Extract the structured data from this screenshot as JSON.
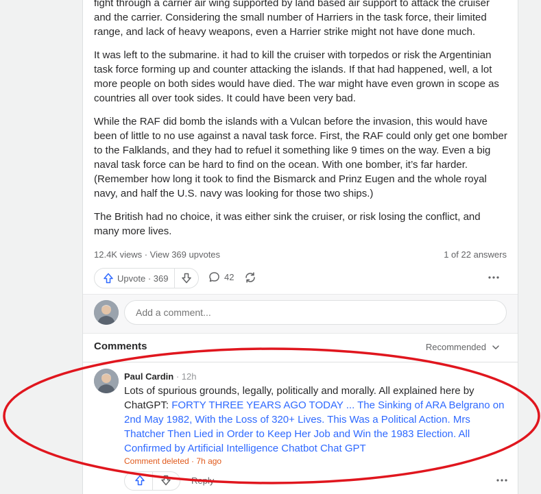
{
  "answer": {
    "paragraphs": [
      "fight through a carrier air wing supported by land based air support to attack the cruiser and the carrier. Considering the small number of Harriers in the task force, their limited range, and lack of heavy weapons, even a Harrier strike might not have done much.",
      "It was left to the submarine. it had to kill the cruiser with torpedos or risk the Argentinian task force forming up and counter attacking the islands. If that had happened, well, a lot more people on both sides would have died. The war might have even grown in scope as countries all over took sides. It could have been very bad.",
      "While the RAF did bomb the islands with a Vulcan before the invasion, this would have been of little to no use against a naval task force. First, the RAF could only get one bomber to the Falklands, and they had to refuel it something like 9 times on the way. Even a big naval task force can be hard to find on the ocean. With one bomber, it’s far harder. (Remember how long it took to find the Bismarck and Prinz Eugen and the whole royal navy, and half the U.S. navy was looking for those two ships.)",
      "The British had no choice, it was either sink the cruiser, or risk losing the conflict, and many more lives."
    ],
    "stats": "12.4K views · View 369 upvotes",
    "position": "1 of 22 answers"
  },
  "actions": {
    "upvote_label": "Upvote",
    "upvote_sep": " · ",
    "upvote_count": "369",
    "comment_count": "42"
  },
  "comment_box": {
    "placeholder": "Add a comment..."
  },
  "comments": {
    "title": "Comments",
    "sort_label": "Recommended",
    "items": [
      {
        "author": "Paul Cardin",
        "time": " · 12h",
        "text_plain": "Lots of spurious grounds, legally, politically and morally. All explained here by ChatGPT: ",
        "link_text": "FORTY THREE YEARS AGO TODAY ... The Sinking of ARA Belgrano on 2nd May 1982, With the Loss of 320+ Lives. This Was a Political Action. Mrs Thatcher Then Lied in Order to Keep Her Job and Win the 1983 Election. All Confirmed by Artificial Intelligence Chatbot Chat GPT",
        "status": "Comment deleted · 7h ago",
        "reply_label": "Reply"
      }
    ]
  },
  "colors": {
    "accent": "#2e69ff",
    "deleted": "#e0591b",
    "annotation": "#e0161e"
  },
  "icons": [
    "upvote-arrow-icon",
    "downvote-arrow-icon",
    "comment-bubble-icon",
    "share-reshare-icon",
    "more-dots-icon",
    "chevron-down-icon",
    "user-avatar"
  ]
}
